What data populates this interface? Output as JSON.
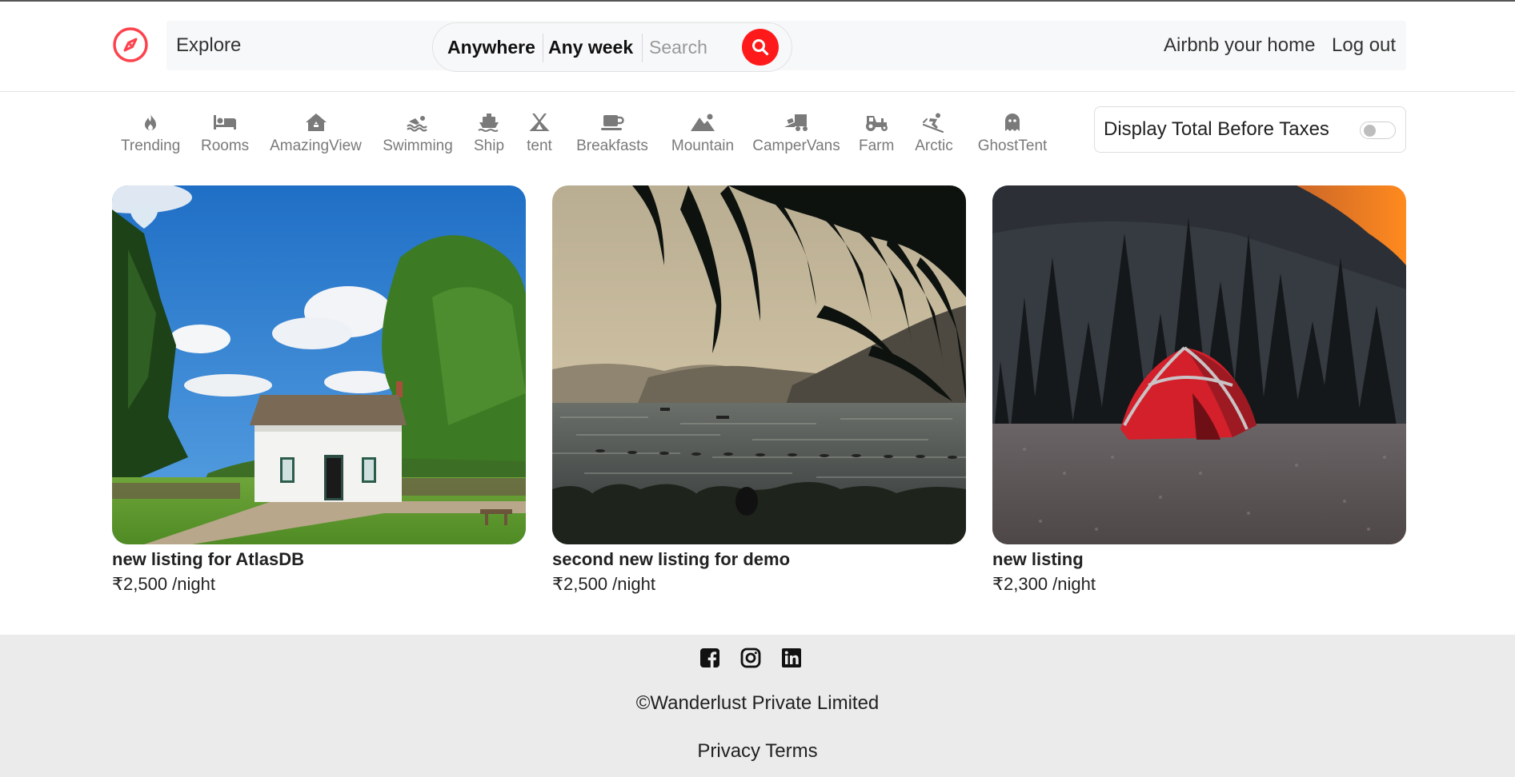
{
  "navbar": {
    "logo_icon": "compass-icon",
    "explore": "Explore",
    "search": {
      "anywhere": "Anywhere",
      "any_week": "Any week",
      "placeholder": "Search destinations",
      "button_icon": "search-icon"
    },
    "host_link": "Airbnb your home",
    "logout_link": "Log out",
    "accent_color": "#fe1a1a"
  },
  "filters": [
    {
      "label": "Trending",
      "icon": "fire-icon"
    },
    {
      "label": "Rooms",
      "icon": "bed-icon"
    },
    {
      "label": "AmazingView",
      "icon": "house-icon"
    },
    {
      "label": "Swimming",
      "icon": "swimmer-icon"
    },
    {
      "label": "Ship",
      "icon": "ship-icon"
    },
    {
      "label": "tent",
      "icon": "tent-icon"
    },
    {
      "label": "Breakfasts",
      "icon": "mug-icon"
    },
    {
      "label": "Mountain",
      "icon": "mountain-icon"
    },
    {
      "label": "CamperVans",
      "icon": "truck-ramp-icon"
    },
    {
      "label": "Farm",
      "icon": "tractor-icon"
    },
    {
      "label": "Arctic",
      "icon": "skier-icon"
    },
    {
      "label": "GhostTent",
      "icon": "ghost-icon"
    }
  ],
  "tax_toggle": {
    "label": "Display Total Before Taxes",
    "checked": false
  },
  "listings": [
    {
      "title": "new listing for AtlasDB",
      "price": "₹2,500 /night",
      "image": "white house under blue sky"
    },
    {
      "title": "second new listing for demo",
      "price": "₹2,500 /night",
      "image": "lake with palm leaves"
    },
    {
      "title": "new listing",
      "price": "₹2,300 /night",
      "image": "red tent under mountain"
    }
  ],
  "footer": {
    "socials": [
      "facebook-icon",
      "instagram-icon",
      "linkedin-icon"
    ],
    "copyright": "©Wanderlust Private Limited",
    "privacy": "Privacy",
    "terms": "Terms"
  }
}
